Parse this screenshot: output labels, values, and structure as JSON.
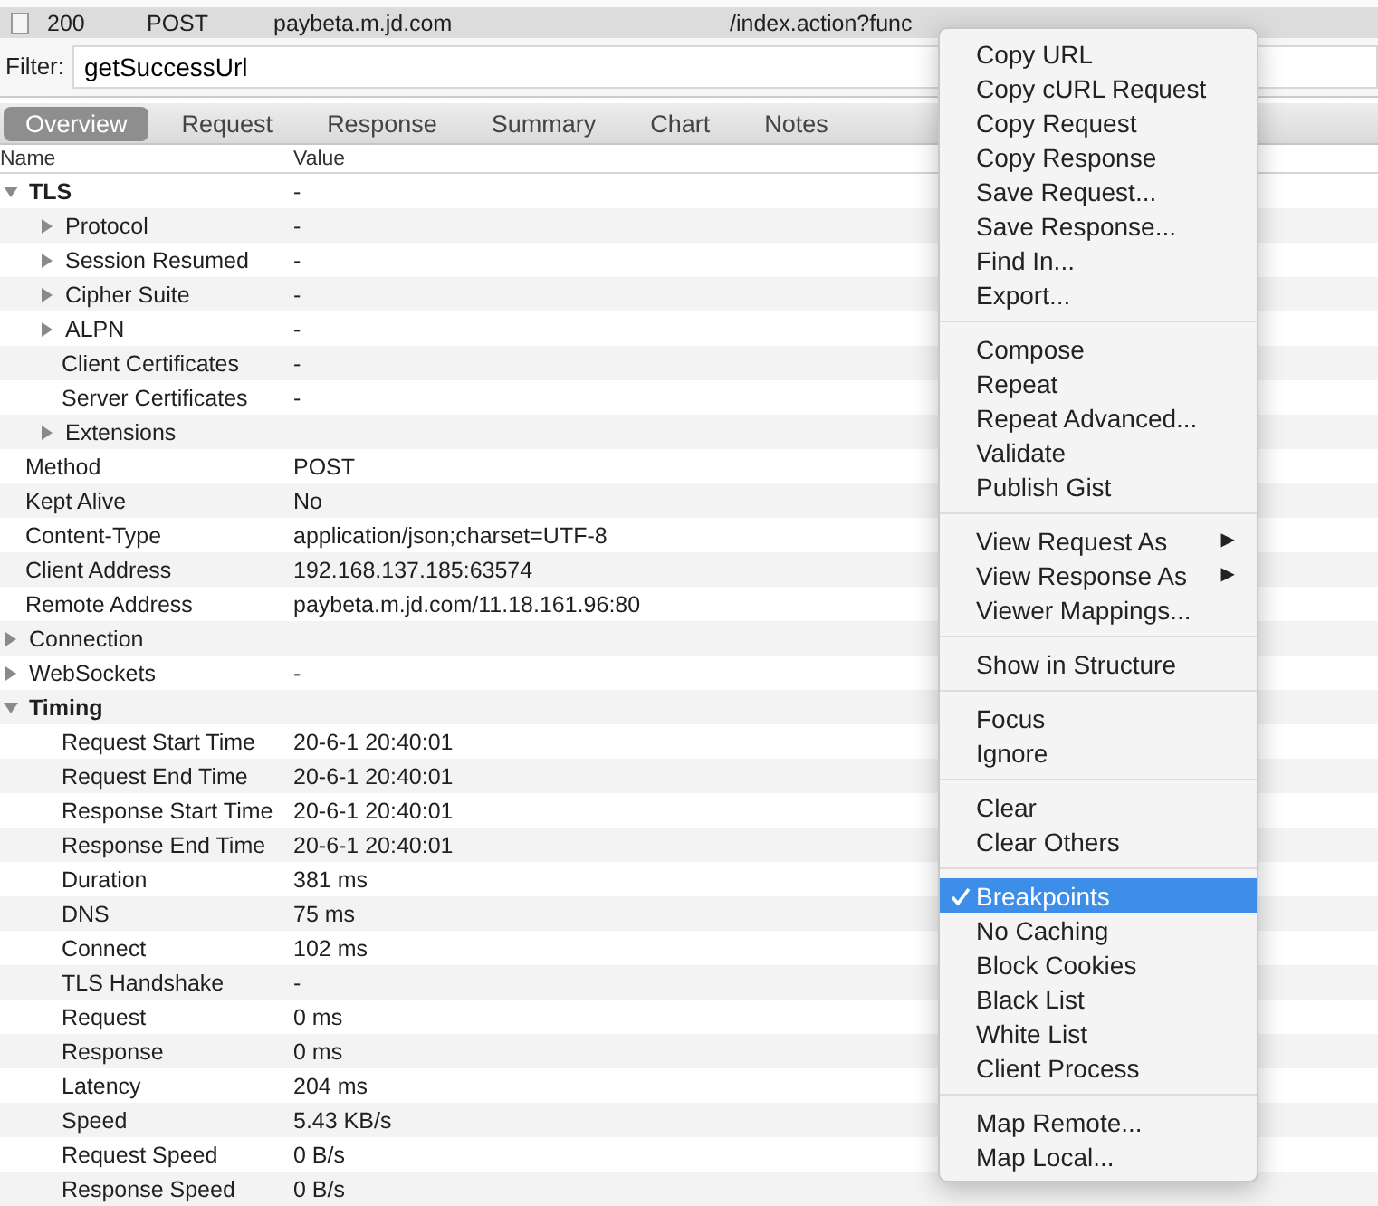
{
  "request_row": {
    "status": "200",
    "method": "POST",
    "host": "paybeta.m.jd.com",
    "path": "/index.action?func"
  },
  "filter": {
    "label": "Filter:",
    "value": "getSuccessUrl"
  },
  "tabs": [
    {
      "label": "Overview",
      "selected": true
    },
    {
      "label": "Request",
      "selected": false
    },
    {
      "label": "Response",
      "selected": false
    },
    {
      "label": "Summary",
      "selected": false
    },
    {
      "label": "Chart",
      "selected": false
    },
    {
      "label": "Notes",
      "selected": false
    }
  ],
  "columns": [
    "Name",
    "Value"
  ],
  "tree": [
    {
      "name": "TLS",
      "value": "-",
      "expanded": true,
      "children": [
        {
          "name": "Protocol",
          "value": "-",
          "expanded": false
        },
        {
          "name": "Session Resumed",
          "value": "-",
          "expanded": false
        },
        {
          "name": "Cipher Suite",
          "value": "-",
          "expanded": false
        },
        {
          "name": "ALPN",
          "value": "-",
          "expanded": false
        },
        {
          "name": "Client Certificates",
          "value": "-"
        },
        {
          "name": "Server Certificates",
          "value": "-"
        },
        {
          "name": "Extensions",
          "expanded": false
        }
      ]
    },
    {
      "name": "Method",
      "value": "POST"
    },
    {
      "name": "Kept Alive",
      "value": "No"
    },
    {
      "name": "Content-Type",
      "value": "application/json;charset=UTF-8"
    },
    {
      "name": "Client Address",
      "value": "192.168.137.185:63574"
    },
    {
      "name": "Remote Address",
      "value": "paybeta.m.jd.com/11.18.161.96:80"
    },
    {
      "name": "Connection",
      "expanded": false
    },
    {
      "name": "WebSockets",
      "value": "-",
      "expanded": false
    },
    {
      "name": "Timing",
      "expanded": true,
      "children": [
        {
          "name": "Request Start Time",
          "value": "20-6-1 20:40:01"
        },
        {
          "name": "Request End Time",
          "value": "20-6-1 20:40:01"
        },
        {
          "name": "Response Start Time",
          "value": "20-6-1 20:40:01"
        },
        {
          "name": "Response End Time",
          "value": "20-6-1 20:40:01"
        },
        {
          "name": "Duration",
          "value": "381 ms"
        },
        {
          "name": "DNS",
          "value": "75 ms"
        },
        {
          "name": "Connect",
          "value": "102 ms"
        },
        {
          "name": "TLS Handshake",
          "value": "-"
        },
        {
          "name": "Request",
          "value": "0 ms"
        },
        {
          "name": "Response",
          "value": "0 ms"
        },
        {
          "name": "Latency",
          "value": "204 ms"
        },
        {
          "name": "Speed",
          "value": "5.43 KB/s"
        },
        {
          "name": "Request Speed",
          "value": "0 B/s"
        },
        {
          "name": "Response Speed",
          "value": "0 B/s"
        }
      ]
    }
  ],
  "context_menu": [
    [
      {
        "label": "Copy URL",
        "selected": false,
        "checked": false
      },
      {
        "label": "Copy cURL Request",
        "selected": false,
        "checked": false
      },
      {
        "label": "Copy Request",
        "selected": false,
        "checked": false
      },
      {
        "label": "Copy Response",
        "selected": false,
        "checked": false
      },
      {
        "label": "Save Request...",
        "selected": false,
        "checked": false
      },
      {
        "label": "Save Response...",
        "selected": false,
        "checked": false
      },
      {
        "label": "Find In...",
        "selected": false,
        "checked": false
      },
      {
        "label": "Export...",
        "selected": false,
        "checked": false
      }
    ],
    [
      {
        "label": "Compose",
        "selected": false,
        "checked": false
      },
      {
        "label": "Repeat",
        "selected": false,
        "checked": false
      },
      {
        "label": "Repeat Advanced...",
        "selected": false,
        "checked": false
      },
      {
        "label": "Validate",
        "selected": false,
        "checked": false
      },
      {
        "label": "Publish Gist",
        "selected": false,
        "checked": false
      }
    ],
    [
      {
        "label": "View Request As",
        "selected": false,
        "checked": false,
        "arrow": "▶"
      },
      {
        "label": "View Response As",
        "selected": false,
        "checked": false,
        "arrow": "▶"
      },
      {
        "label": "Viewer Mappings...",
        "selected": false,
        "checked": false
      }
    ],
    [
      {
        "label": "Show in Structure",
        "selected": false,
        "checked": false
      }
    ],
    [
      {
        "label": "Focus",
        "selected": false,
        "checked": false
      },
      {
        "label": "Ignore",
        "selected": false,
        "checked": false
      }
    ],
    [
      {
        "label": "Clear",
        "selected": false,
        "checked": false
      },
      {
        "label": "Clear Others",
        "selected": false,
        "checked": false
      }
    ],
    [
      {
        "label": "Breakpoints",
        "selected": true,
        "checked": true
      },
      {
        "label": "No Caching",
        "selected": false,
        "checked": false
      },
      {
        "label": "Block Cookies",
        "selected": false,
        "checked": false
      },
      {
        "label": "Black List",
        "selected": false,
        "checked": false
      },
      {
        "label": "White List",
        "selected": false,
        "checked": false
      },
      {
        "label": "Client Process",
        "selected": false,
        "checked": false
      }
    ],
    [
      {
        "label": "Map Remote...",
        "selected": false,
        "checked": false
      },
      {
        "label": "Map Local...",
        "selected": false,
        "checked": false
      }
    ]
  ]
}
